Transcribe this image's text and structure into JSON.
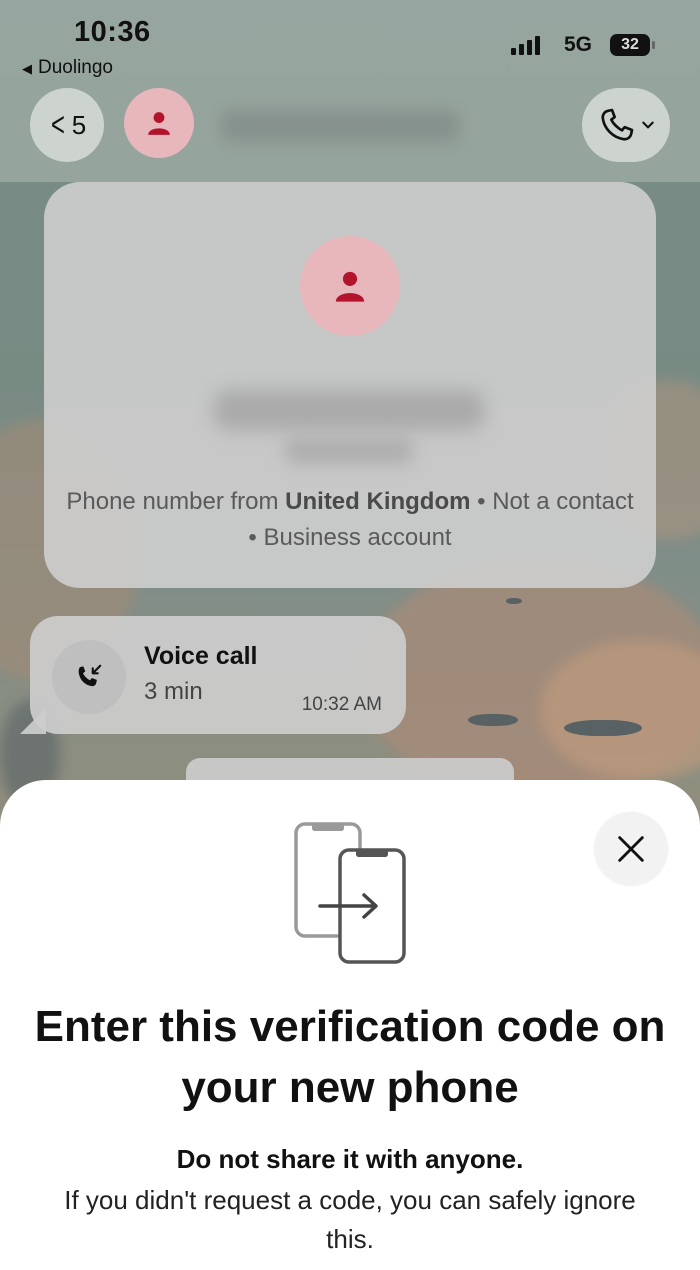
{
  "status_bar": {
    "time": "10:36",
    "back_app": "Duolingo",
    "network": "5G",
    "battery": "32"
  },
  "header": {
    "back_count": "5",
    "call_icon": "phone-icon",
    "dropdown_icon": "chevron-down-icon"
  },
  "contact_card": {
    "avatar_icon": "person-icon",
    "info_prefix": "Phone number from ",
    "info_country": "United Kingdom",
    "info_suffix": " • Not a contact • Business account"
  },
  "call_message": {
    "title": "Voice call",
    "duration": "3 min",
    "time": "10:32 AM",
    "icon": "incoming-call-icon"
  },
  "sheet": {
    "icon": "phone-transfer-icon",
    "title": "Enter this verification code on your new phone",
    "subtitle": "Do not share it with anyone.",
    "body": "If you didn't request a code, you can safely ignore this.",
    "close_icon": "close-icon"
  },
  "colors": {
    "accent_avatar_bg": "#e7b7bc",
    "accent_avatar_fg": "#b3142b"
  }
}
